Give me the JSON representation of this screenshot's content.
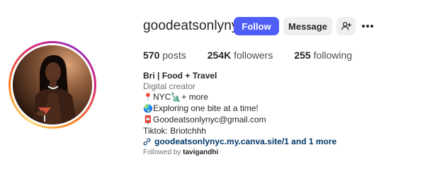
{
  "profile": {
    "username": "goodeatsonlynyc",
    "follow_label": "Follow",
    "message_label": "Message",
    "add_user_icon": "add-person-icon",
    "more_icon": "more-horizontal-icon"
  },
  "stats": {
    "posts_count": "570",
    "posts_label": "posts",
    "followers_count": "254K",
    "followers_label": "followers",
    "following_count": "255",
    "following_label": "following"
  },
  "bio": {
    "name": "Bri | Food + Travel",
    "category": "Digital creator",
    "line1_emoji": "📍",
    "line1_text": "NYC🗽+ more",
    "line2_emoji": "🌏",
    "line2_text": "Exploring one bite at a time!",
    "line3_emoji": "📮",
    "line3_text": "Goodeatsonlynyc@gmail.com",
    "line4_text": "Tiktok: Briotchhh",
    "link_icon": "link-icon",
    "link_text": "goodeatsonlynyc.my.canva.site/1 and 1 more"
  },
  "followed_by": {
    "prefix": "Followed by",
    "user": "tavigandhi"
  },
  "colors": {
    "follow_button": "#4e5ef6",
    "secondary_button": "#efefef",
    "link": "#00376b",
    "muted_text": "#737373"
  }
}
